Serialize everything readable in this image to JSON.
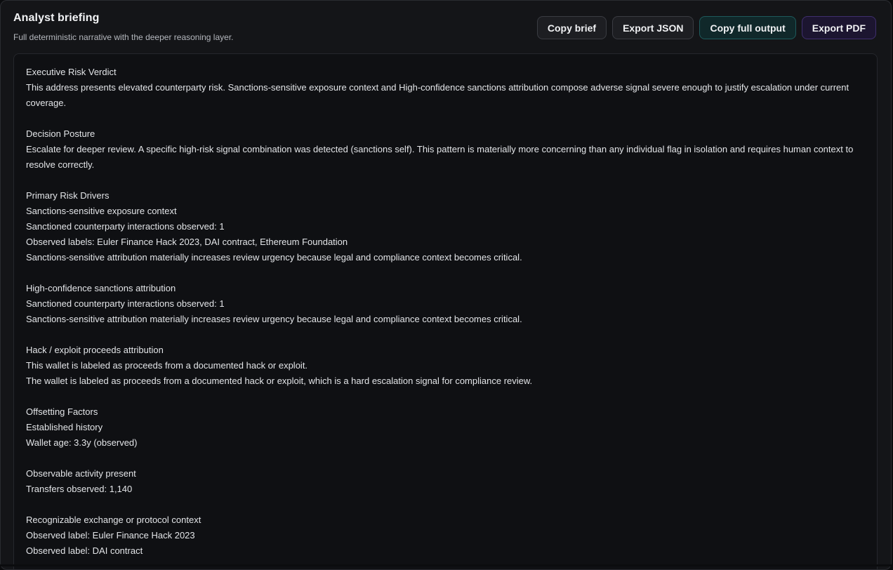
{
  "header": {
    "title": "Analyst briefing",
    "subtitle": "Full deterministic narrative with the deeper reasoning layer."
  },
  "actions": {
    "copy_brief": "Copy brief",
    "export_json": "Export JSON",
    "copy_full_output": "Copy full output",
    "export_pdf": "Export PDF"
  },
  "sections": [
    {
      "heading": "Executive Risk Verdict",
      "lines": [
        "This address presents elevated counterparty risk. Sanctions-sensitive exposure context and High-confidence sanctions attribution compose adverse signal severe enough to justify escalation under current coverage."
      ]
    },
    {
      "heading": "Decision Posture",
      "lines": [
        "Escalate for deeper review. A specific high-risk signal combination was detected (sanctions self). This pattern is materially more concerning than any individual flag in isolation and requires human context to resolve correctly."
      ]
    },
    {
      "heading": "Primary Risk Drivers",
      "lines": [
        "Sanctions-sensitive exposure context",
        "Sanctioned counterparty interactions observed: 1",
        "Observed labels: Euler Finance Hack 2023, DAI contract, Ethereum Foundation",
        "Sanctions-sensitive attribution materially increases review urgency because legal and compliance context becomes critical."
      ]
    },
    {
      "heading": "High-confidence sanctions attribution",
      "lines": [
        "Sanctioned counterparty interactions observed: 1",
        "Sanctions-sensitive attribution materially increases review urgency because legal and compliance context becomes critical."
      ]
    },
    {
      "heading": "Hack / exploit proceeds attribution",
      "lines": [
        "This wallet is labeled as proceeds from a documented hack or exploit.",
        "The wallet is labeled as proceeds from a documented hack or exploit, which is a hard escalation signal for compliance review."
      ]
    },
    {
      "heading": "Offsetting Factors",
      "lines": [
        "Established history",
        "Wallet age: 3.3y (observed)"
      ]
    },
    {
      "heading": "Observable activity present",
      "lines": [
        "Transfers observed: 1,140"
      ]
    },
    {
      "heading": "Recognizable exchange or protocol context",
      "lines": [
        "Observed label: Euler Finance Hack 2023",
        "Observed label: DAI contract"
      ]
    }
  ]
}
